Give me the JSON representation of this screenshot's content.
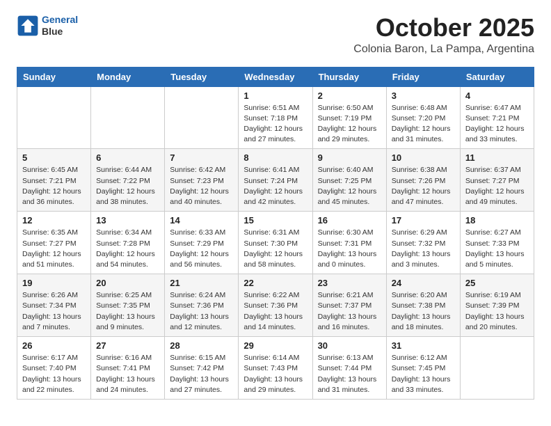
{
  "header": {
    "logo_line1": "General",
    "logo_line2": "Blue",
    "month_title": "October 2025",
    "location": "Colonia Baron, La Pampa, Argentina"
  },
  "weekdays": [
    "Sunday",
    "Monday",
    "Tuesday",
    "Wednesday",
    "Thursday",
    "Friday",
    "Saturday"
  ],
  "weeks": [
    [
      {
        "day": "",
        "info": ""
      },
      {
        "day": "",
        "info": ""
      },
      {
        "day": "",
        "info": ""
      },
      {
        "day": "1",
        "info": "Sunrise: 6:51 AM\nSunset: 7:18 PM\nDaylight: 12 hours\nand 27 minutes."
      },
      {
        "day": "2",
        "info": "Sunrise: 6:50 AM\nSunset: 7:19 PM\nDaylight: 12 hours\nand 29 minutes."
      },
      {
        "day": "3",
        "info": "Sunrise: 6:48 AM\nSunset: 7:20 PM\nDaylight: 12 hours\nand 31 minutes."
      },
      {
        "day": "4",
        "info": "Sunrise: 6:47 AM\nSunset: 7:21 PM\nDaylight: 12 hours\nand 33 minutes."
      }
    ],
    [
      {
        "day": "5",
        "info": "Sunrise: 6:45 AM\nSunset: 7:21 PM\nDaylight: 12 hours\nand 36 minutes."
      },
      {
        "day": "6",
        "info": "Sunrise: 6:44 AM\nSunset: 7:22 PM\nDaylight: 12 hours\nand 38 minutes."
      },
      {
        "day": "7",
        "info": "Sunrise: 6:42 AM\nSunset: 7:23 PM\nDaylight: 12 hours\nand 40 minutes."
      },
      {
        "day": "8",
        "info": "Sunrise: 6:41 AM\nSunset: 7:24 PM\nDaylight: 12 hours\nand 42 minutes."
      },
      {
        "day": "9",
        "info": "Sunrise: 6:40 AM\nSunset: 7:25 PM\nDaylight: 12 hours\nand 45 minutes."
      },
      {
        "day": "10",
        "info": "Sunrise: 6:38 AM\nSunset: 7:26 PM\nDaylight: 12 hours\nand 47 minutes."
      },
      {
        "day": "11",
        "info": "Sunrise: 6:37 AM\nSunset: 7:27 PM\nDaylight: 12 hours\nand 49 minutes."
      }
    ],
    [
      {
        "day": "12",
        "info": "Sunrise: 6:35 AM\nSunset: 7:27 PM\nDaylight: 12 hours\nand 51 minutes."
      },
      {
        "day": "13",
        "info": "Sunrise: 6:34 AM\nSunset: 7:28 PM\nDaylight: 12 hours\nand 54 minutes."
      },
      {
        "day": "14",
        "info": "Sunrise: 6:33 AM\nSunset: 7:29 PM\nDaylight: 12 hours\nand 56 minutes."
      },
      {
        "day": "15",
        "info": "Sunrise: 6:31 AM\nSunset: 7:30 PM\nDaylight: 12 hours\nand 58 minutes."
      },
      {
        "day": "16",
        "info": "Sunrise: 6:30 AM\nSunset: 7:31 PM\nDaylight: 13 hours\nand 0 minutes."
      },
      {
        "day": "17",
        "info": "Sunrise: 6:29 AM\nSunset: 7:32 PM\nDaylight: 13 hours\nand 3 minutes."
      },
      {
        "day": "18",
        "info": "Sunrise: 6:27 AM\nSunset: 7:33 PM\nDaylight: 13 hours\nand 5 minutes."
      }
    ],
    [
      {
        "day": "19",
        "info": "Sunrise: 6:26 AM\nSunset: 7:34 PM\nDaylight: 13 hours\nand 7 minutes."
      },
      {
        "day": "20",
        "info": "Sunrise: 6:25 AM\nSunset: 7:35 PM\nDaylight: 13 hours\nand 9 minutes."
      },
      {
        "day": "21",
        "info": "Sunrise: 6:24 AM\nSunset: 7:36 PM\nDaylight: 13 hours\nand 12 minutes."
      },
      {
        "day": "22",
        "info": "Sunrise: 6:22 AM\nSunset: 7:36 PM\nDaylight: 13 hours\nand 14 minutes."
      },
      {
        "day": "23",
        "info": "Sunrise: 6:21 AM\nSunset: 7:37 PM\nDaylight: 13 hours\nand 16 minutes."
      },
      {
        "day": "24",
        "info": "Sunrise: 6:20 AM\nSunset: 7:38 PM\nDaylight: 13 hours\nand 18 minutes."
      },
      {
        "day": "25",
        "info": "Sunrise: 6:19 AM\nSunset: 7:39 PM\nDaylight: 13 hours\nand 20 minutes."
      }
    ],
    [
      {
        "day": "26",
        "info": "Sunrise: 6:17 AM\nSunset: 7:40 PM\nDaylight: 13 hours\nand 22 minutes."
      },
      {
        "day": "27",
        "info": "Sunrise: 6:16 AM\nSunset: 7:41 PM\nDaylight: 13 hours\nand 24 minutes."
      },
      {
        "day": "28",
        "info": "Sunrise: 6:15 AM\nSunset: 7:42 PM\nDaylight: 13 hours\nand 27 minutes."
      },
      {
        "day": "29",
        "info": "Sunrise: 6:14 AM\nSunset: 7:43 PM\nDaylight: 13 hours\nand 29 minutes."
      },
      {
        "day": "30",
        "info": "Sunrise: 6:13 AM\nSunset: 7:44 PM\nDaylight: 13 hours\nand 31 minutes."
      },
      {
        "day": "31",
        "info": "Sunrise: 6:12 AM\nSunset: 7:45 PM\nDaylight: 13 hours\nand 33 minutes."
      },
      {
        "day": "",
        "info": ""
      }
    ]
  ]
}
